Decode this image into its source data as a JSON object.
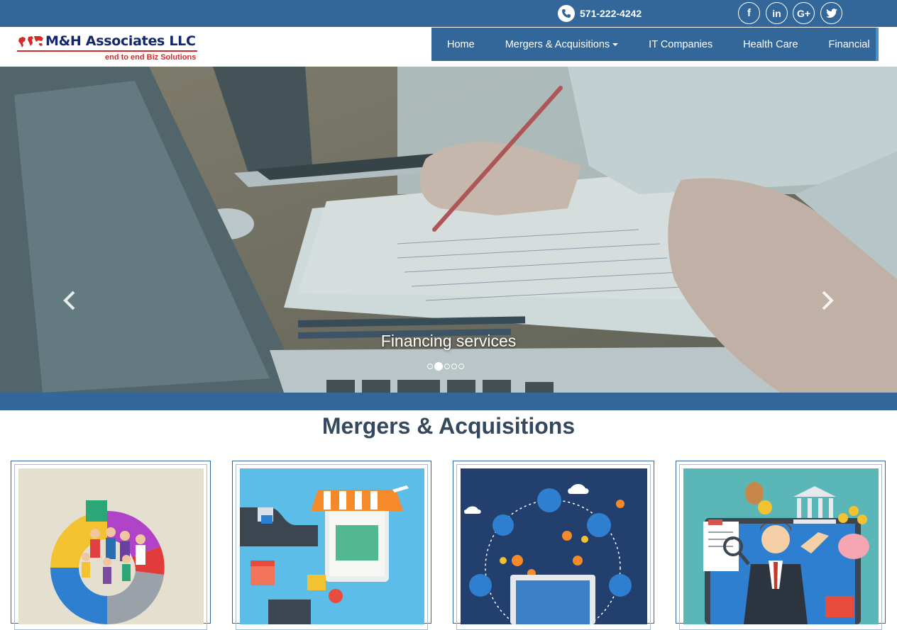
{
  "topbar": {
    "phone": "571-222-4242",
    "social": [
      {
        "icon": "facebook-icon",
        "glyph": "f"
      },
      {
        "icon": "linkedin-icon",
        "glyph": "in"
      },
      {
        "icon": "google-plus-icon",
        "glyph": "G+"
      },
      {
        "icon": "twitter-icon",
        "glyph": ""
      }
    ]
  },
  "logo": {
    "title": "M&H Associates LLC",
    "tagline": "end to end Biz Solutions"
  },
  "nav": {
    "items": [
      {
        "label": "Home"
      },
      {
        "label": "Mergers & Acquisitions",
        "dropdown": true
      },
      {
        "label": "IT Companies"
      },
      {
        "label": "Health Care"
      },
      {
        "label": "Financial"
      }
    ]
  },
  "hero": {
    "caption": "Financing services",
    "slide_count": 5,
    "active_slide": 2
  },
  "section": {
    "title": "Mergers & Acquisitions"
  },
  "colors": {
    "brand_blue": "#336699",
    "logo_red": "#d42a2a",
    "logo_navy": "#13286b",
    "heading": "#34495e"
  }
}
